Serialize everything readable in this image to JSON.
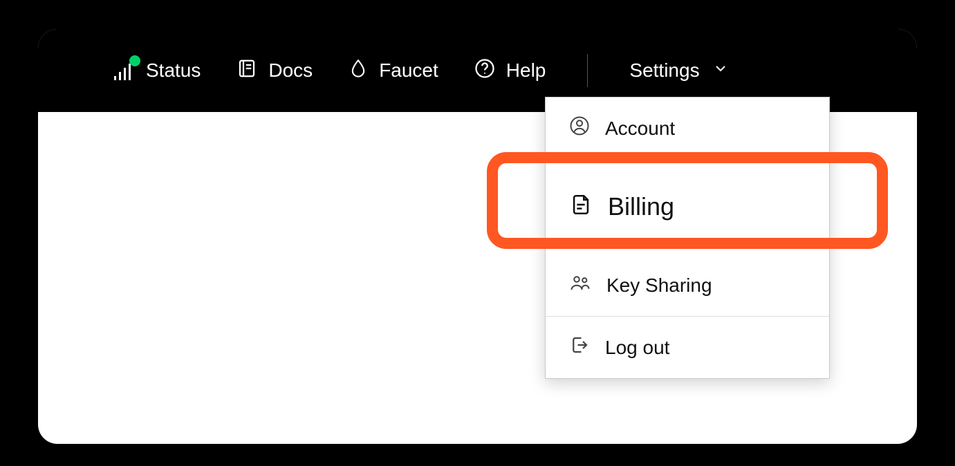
{
  "topbar": {
    "status": "Status",
    "docs": "Docs",
    "faucet": "Faucet",
    "help": "Help",
    "settings": "Settings"
  },
  "dropdown": {
    "account": "Account",
    "billing": "Billing",
    "key_sharing": "Key Sharing",
    "logout": "Log out"
  },
  "colors": {
    "highlight": "#ff5722",
    "status_dot": "#00d26a"
  }
}
